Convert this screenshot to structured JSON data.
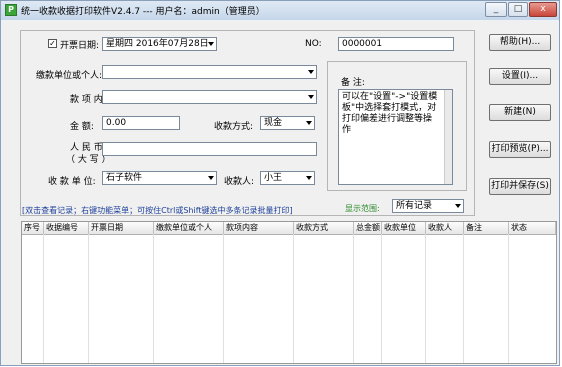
{
  "window": {
    "title": "统一收款收据打印软件V2.4.7 --- 用户名：admin（管理员）",
    "app_icon_glyph": "P",
    "controls": [
      "_",
      "□",
      "x"
    ]
  },
  "form": {
    "invoice_date": {
      "checked_mark": "✓",
      "label": "开票日期:",
      "value": "星期四 2016年07月28日"
    },
    "no": {
      "label": "NO:",
      "value": "0000001"
    },
    "payer": {
      "label": "缴款单位或个人:",
      "value": ""
    },
    "item": {
      "label": "款 项 内 容:",
      "value": ""
    },
    "amount": {
      "label": "金      额:",
      "value": "0.00"
    },
    "pay_method": {
      "label": "收款方式:",
      "value": "现金"
    },
    "rmb_upper": {
      "label_line1": "人   民   币",
      "label_line2": "（ 大   写 ）",
      "value": ""
    },
    "receiver_unit": {
      "label": "收 款 单 位:",
      "value": "石子软件"
    },
    "receiver": {
      "label": "收款人:",
      "value": "小王"
    },
    "remark": {
      "label": "备 注:",
      "text": "可以在\"设置\"->\"设置模板\"中选择套打模式，对打印偏差进行调整等操作"
    }
  },
  "buttons": {
    "help": "帮助(H)...",
    "settings": "设置(I)...",
    "new": "新建(N)",
    "preview": "打印预览(P)...",
    "print_save": "打印并保存(S)"
  },
  "hint": "[双击查看记录；右键功能菜单；可按住Ctrl或Shift键选中多条记录批量打印]",
  "range": {
    "label": "显示范围:",
    "value": "所有记录"
  },
  "table": {
    "columns": [
      "序号",
      "收据编号",
      "开票日期",
      "缴款单位或个人",
      "款项内容",
      "收款方式",
      "总金额",
      "收款单位",
      "收款人",
      "备注",
      "状态"
    ],
    "rows": []
  },
  "colors": {
    "hint_blue": "#1d3f9a",
    "range_green": "#2a8a2a",
    "close_red": "#c8463a"
  }
}
